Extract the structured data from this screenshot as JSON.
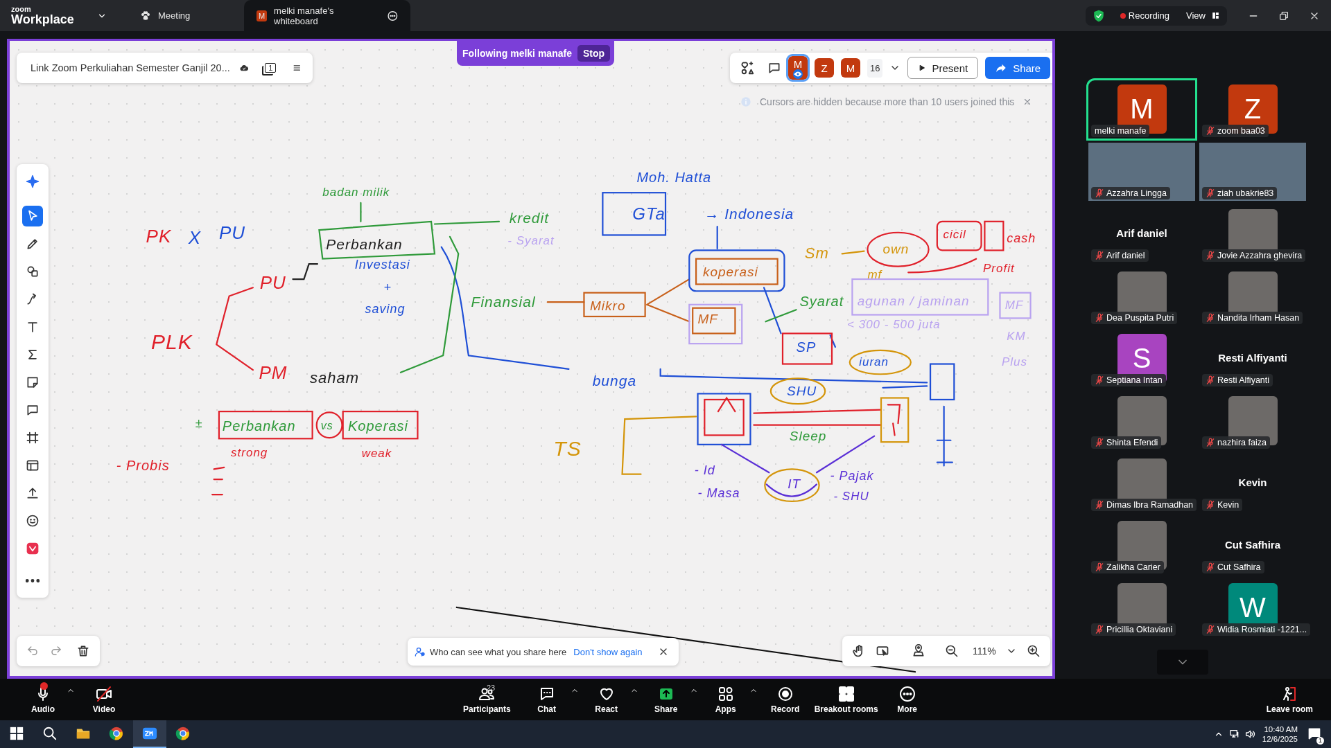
{
  "title_bar": {
    "logo": "zoom",
    "product": "Workplace",
    "tabs": [
      {
        "label": "Meeting",
        "kind": "meeting",
        "selected": false
      },
      {
        "label": "melki manafe's whiteboard",
        "kind": "whiteboard",
        "avatar": "M",
        "selected": true
      }
    ],
    "recording": "Recording",
    "view": "View"
  },
  "whiteboard": {
    "document_title": "Link Zoom Perkuliahan Semester Ganjil 20...",
    "page_count": "1",
    "following": "Following melki manafe",
    "stop": "Stop",
    "collaborators": [
      {
        "initial": "M",
        "selected": true
      },
      {
        "initial": "Z",
        "selected": false
      },
      {
        "initial": "M",
        "selected": false
      }
    ],
    "collaborator_count": "16",
    "present": "Present",
    "share": "Share",
    "notice": "Cursors are hidden because more than 10 users joined this",
    "tools": [
      {
        "kind": "ai",
        "selected": false
      },
      {
        "kind": "select",
        "selected": true
      },
      {
        "kind": "pen",
        "selected": false
      },
      {
        "kind": "shapes",
        "selected": false
      },
      {
        "kind": "connector",
        "selected": false
      },
      {
        "kind": "text",
        "selected": false
      },
      {
        "kind": "formula",
        "selected": false
      },
      {
        "kind": "sticky",
        "selected": false
      },
      {
        "kind": "comment",
        "selected": false
      },
      {
        "kind": "frame",
        "selected": false
      },
      {
        "kind": "template",
        "selected": false
      },
      {
        "kind": "upload",
        "selected": false
      },
      {
        "kind": "emoji",
        "selected": false
      },
      {
        "kind": "app",
        "selected": false
      },
      {
        "kind": "more",
        "selected": false
      }
    ],
    "notes": [
      {
        "text": "Moh. Hatta",
        "color": "#1f4fd6"
      },
      {
        "text": "GTa",
        "color": "#1f4fd6"
      },
      {
        "text": "→ Indonesia",
        "color": "#1f4fd6"
      },
      {
        "text": "badan milik",
        "color": "#2f9a3a"
      },
      {
        "text": "PK",
        "color": "#e0202a"
      },
      {
        "text": "X",
        "color": "#1f4fd6"
      },
      {
        "text": "PU",
        "color": "#1f4fd6"
      },
      {
        "text": "Perbankan",
        "color": "#222222"
      },
      {
        "text": "kredit",
        "color": "#2f9a3a"
      },
      {
        "text": "- Syarat",
        "color": "#b9a2f0"
      },
      {
        "text": "Investasi",
        "color": "#1f4fd6"
      },
      {
        "text": "+",
        "color": "#1f4fd6"
      },
      {
        "text": "saving",
        "color": "#1f4fd6"
      },
      {
        "text": "PU",
        "color": "#e0202a"
      },
      {
        "text": "PLK",
        "color": "#e0202a"
      },
      {
        "text": "PM",
        "color": "#e0202a"
      },
      {
        "text": "saham",
        "color": "#222222"
      },
      {
        "text": "Finansial",
        "color": "#2f9a3a"
      },
      {
        "text": "Mikro",
        "color": "#c8601a"
      },
      {
        "text": "koperasi",
        "color": "#c8601a"
      },
      {
        "text": "MF",
        "color": "#c8601a"
      },
      {
        "text": "Sm",
        "color": "#d4950a"
      },
      {
        "text": "own",
        "color": "#d4950a"
      },
      {
        "text": "cicil",
        "color": "#e0202a"
      },
      {
        "text": "cash",
        "color": "#e0202a"
      },
      {
        "text": "Profit",
        "color": "#e0202a"
      },
      {
        "text": "mf",
        "color": "#d4950a"
      },
      {
        "text": "Syarat",
        "color": "#2f9a3a"
      },
      {
        "text": "agunan / jaminan",
        "color": "#b9a2f0"
      },
      {
        "text": "< 300 - 500 juta",
        "color": "#b9a2f0"
      },
      {
        "text": "MF",
        "color": "#b9a2f0"
      },
      {
        "text": "KM",
        "color": "#b9a2f0"
      },
      {
        "text": "Plus",
        "color": "#b9a2f0"
      },
      {
        "text": "SP",
        "color": "#1f4fd6"
      },
      {
        "text": "bunga",
        "color": "#1f4fd6"
      },
      {
        "text": "iuran",
        "color": "#1f4fd6"
      },
      {
        "text": "SHU",
        "color": "#1f4fd6"
      },
      {
        "text": "Sleep",
        "color": "#2f9a3a"
      },
      {
        "text": "TS",
        "color": "#d4950a"
      },
      {
        "text": "±",
        "color": "#2f9a3a"
      },
      {
        "text": "Perbankan",
        "color": "#2f9a3a"
      },
      {
        "text": "vs",
        "color": "#2f9a3a"
      },
      {
        "text": "Koperasi",
        "color": "#2f9a3a"
      },
      {
        "text": "strong",
        "color": "#e0202a"
      },
      {
        "text": "weak",
        "color": "#e0202a"
      },
      {
        "text": "- Probis",
        "color": "#e0202a"
      },
      {
        "text": "- Id",
        "color": "#5a2fd6"
      },
      {
        "text": "- Masa",
        "color": "#5a2fd6"
      },
      {
        "text": "IT",
        "color": "#5a2fd6"
      },
      {
        "text": "- Pajak",
        "color": "#5a2fd6"
      },
      {
        "text": "- SHU",
        "color": "#5a2fd6"
      }
    ],
    "share_hint": "Who can see what you share here",
    "dont_show_again": "Don't show again",
    "zoom_level": "111%"
  },
  "participants": [
    {
      "name": "melki manafe",
      "kind": "avatar",
      "initial": "M",
      "color": "#c2390e",
      "muted": false,
      "speaking": true
    },
    {
      "name": "zoom baa03",
      "kind": "avatar",
      "initial": "Z",
      "color": "#c2390e",
      "muted": true,
      "speaking": false
    },
    {
      "name": "Azzahra Lingga",
      "kind": "video",
      "muted": true,
      "speaking": false
    },
    {
      "name": "ziah ubakrie83",
      "kind": "video",
      "muted": true,
      "speaking": false
    },
    {
      "name": "Arif daniel",
      "kind": "name",
      "display_name": "Arif daniel",
      "muted": true,
      "speaking": false
    },
    {
      "name": "Jovie Azzahra ghevira",
      "kind": "photo",
      "muted": true,
      "speaking": false
    },
    {
      "name": "Dea Puspita Putri",
      "kind": "photo",
      "muted": true,
      "speaking": false
    },
    {
      "name": "Nandita Irham Hasan",
      "kind": "photo",
      "muted": true,
      "speaking": false
    },
    {
      "name": "Septiana Intan",
      "kind": "avatar",
      "initial": "S",
      "color": "#a844c0",
      "muted": true,
      "speaking": false
    },
    {
      "name": "Resti Alfiyanti",
      "kind": "name",
      "display_name": "Resti Alfiyanti",
      "muted": true,
      "speaking": false
    },
    {
      "name": "Shinta Efendi",
      "kind": "photo",
      "muted": true,
      "speaking": false
    },
    {
      "name": "nazhira faiza",
      "kind": "photo",
      "muted": true,
      "speaking": false
    },
    {
      "name": "Dimas Ibra Ramadhan",
      "kind": "photo",
      "muted": true,
      "speaking": false
    },
    {
      "name": "Kevin",
      "kind": "name",
      "display_name": "Kevin",
      "muted": true,
      "speaking": false
    },
    {
      "name": "Zalikha Carier",
      "kind": "photo",
      "muted": true,
      "speaking": false
    },
    {
      "name": "Cut Safhira",
      "kind": "name",
      "display_name": "Cut Safhira",
      "muted": true,
      "speaking": false
    },
    {
      "name": "Pricillia Oktaviani",
      "kind": "photo",
      "muted": true,
      "speaking": false
    },
    {
      "name": "Widia Rosmiati -1221...",
      "kind": "avatar",
      "initial": "W",
      "color": "#00897b",
      "muted": true,
      "speaking": false
    }
  ],
  "meeting_controls": [
    {
      "label": "Audio",
      "kind": "audio",
      "menu": true,
      "alert": true
    },
    {
      "label": "Video",
      "kind": "video",
      "menu": false,
      "off": true
    },
    {
      "label": "Participants",
      "kind": "participants",
      "menu": false,
      "count": "23"
    },
    {
      "label": "Chat",
      "kind": "chat",
      "menu": true
    },
    {
      "label": "React",
      "kind": "react",
      "menu": true
    },
    {
      "label": "Share",
      "kind": "share",
      "menu": true
    },
    {
      "label": "Apps",
      "kind": "apps",
      "menu": true
    },
    {
      "label": "Record",
      "kind": "record",
      "menu": false
    },
    {
      "label": "Breakout rooms",
      "kind": "breakout",
      "menu": false
    },
    {
      "label": "More",
      "kind": "more",
      "menu": false
    },
    {
      "label": "Leave room",
      "kind": "leave",
      "menu": false
    }
  ],
  "taskbar": {
    "apps": [
      {
        "kind": "start",
        "selected": false
      },
      {
        "kind": "search",
        "selected": false
      },
      {
        "kind": "files",
        "selected": false
      },
      {
        "kind": "chrome",
        "selected": false
      },
      {
        "kind": "zoom",
        "selected": true
      },
      {
        "kind": "chrome",
        "selected": false
      }
    ],
    "time": "10:40 AM",
    "date": "12/6/2025",
    "notification_count": "1"
  }
}
